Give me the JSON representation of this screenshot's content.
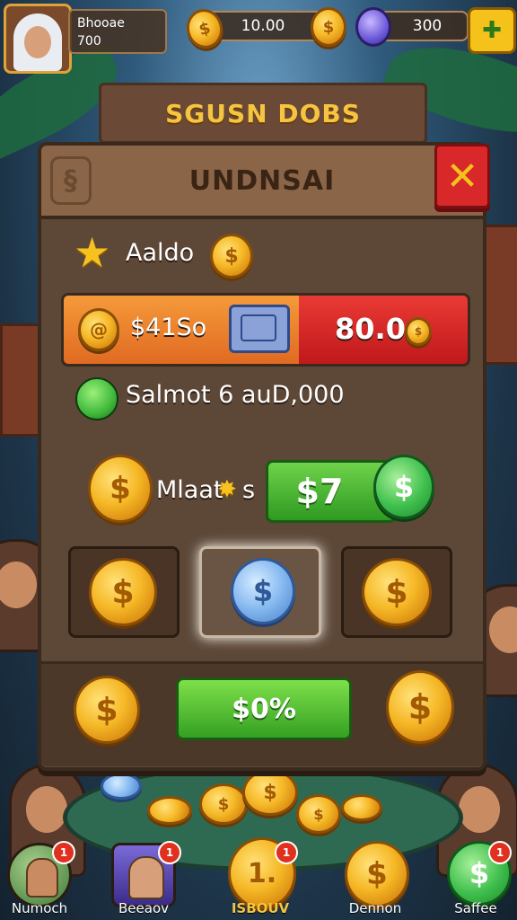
{
  "player": {
    "name": "Bhooae",
    "score": "700"
  },
  "resources": {
    "coins": "10.00",
    "gems": "300",
    "plus_icon": "plus-star-icon"
  },
  "banner": {
    "title": "SGUSN DOBS"
  },
  "modal": {
    "title": "UNDNSAI",
    "balance_label": "Aaldo",
    "offer_left": "$41So",
    "offer_right": "80.0",
    "reward_text": "Salmot 6 auD,000",
    "multiplier_label": "Mlaat",
    "multiplier_suffix": "s",
    "price": "$7",
    "buy_label": "$0%"
  },
  "colors": {
    "accent_gold": "#f6b928",
    "accent_green": "#3fbf4d",
    "accent_red": "#d8282a",
    "panel": "#5d4838"
  },
  "bottom_nav": [
    {
      "label": "Numoch",
      "badge": "1",
      "icon": "character-icon"
    },
    {
      "label": "Beeaov",
      "badge": "1",
      "icon": "hero-portrait-icon"
    },
    {
      "label": "ISBOUV",
      "badge": "1",
      "icon": "coin-icon",
      "coin_text": "1."
    },
    {
      "label": "Dennon",
      "badge": "",
      "icon": "coin-icon"
    },
    {
      "label": "Saffee",
      "badge": "1",
      "icon": "green-coin-icon"
    }
  ]
}
